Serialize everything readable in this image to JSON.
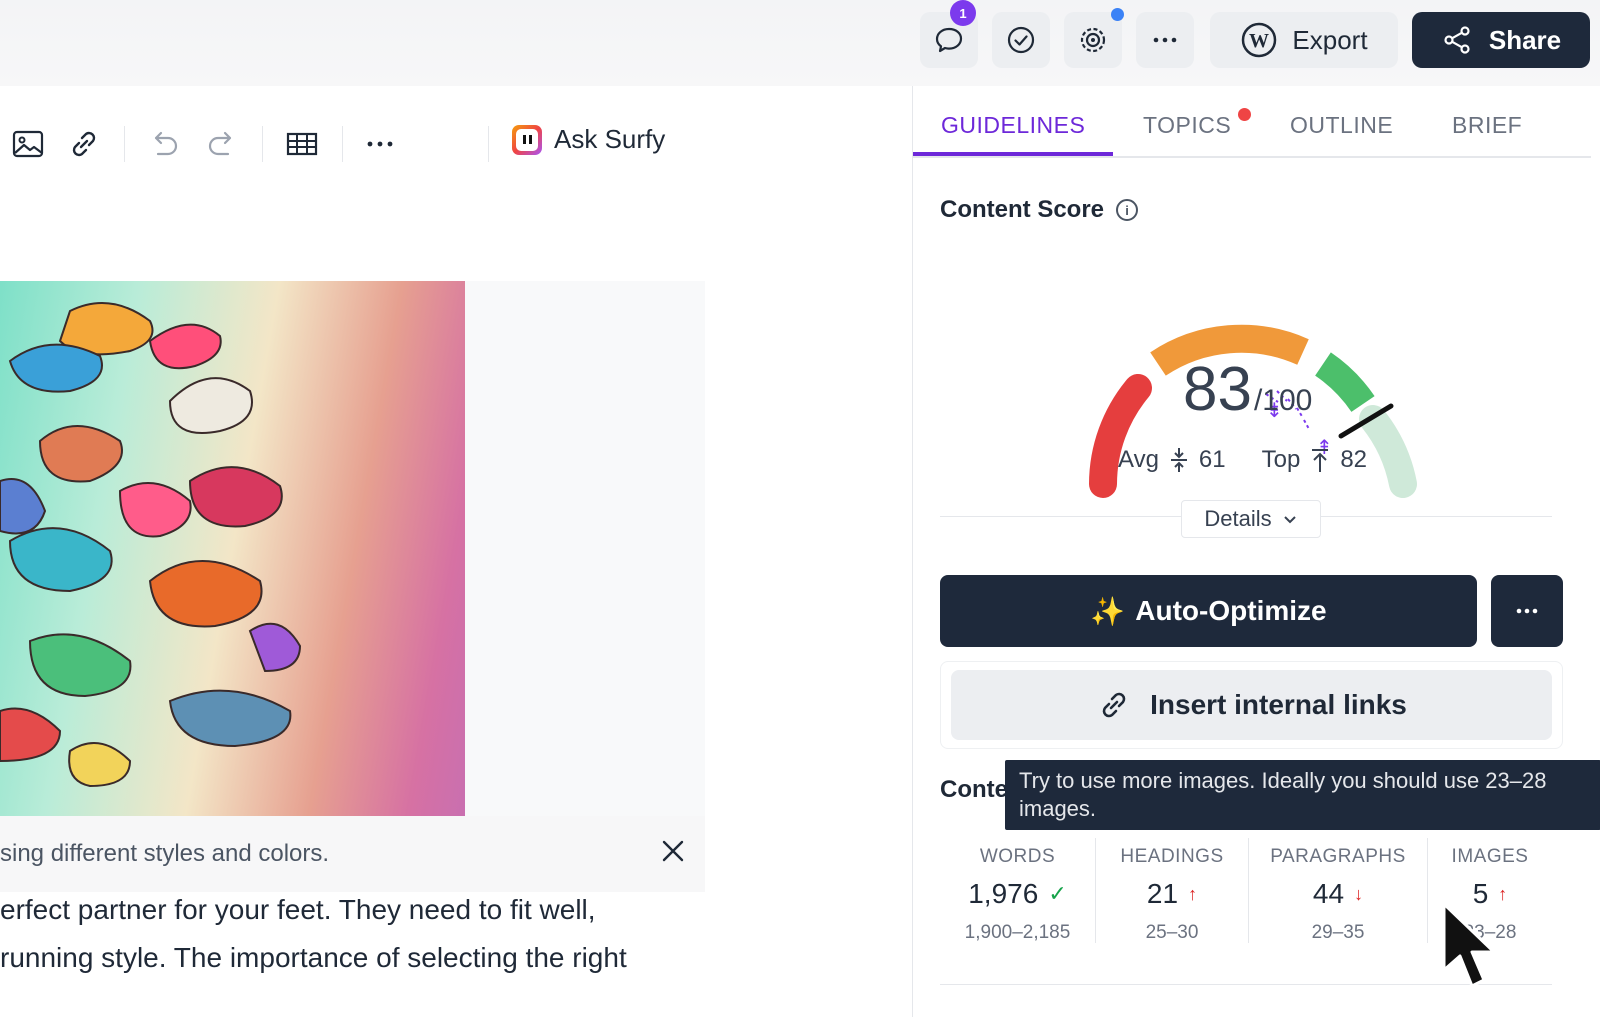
{
  "header": {
    "comments_badge": "1",
    "export_label": "Export",
    "share_label": "Share",
    "icons": [
      "comment-icon",
      "check-circle-icon",
      "settings-icon",
      "more-icon",
      "wordpress-icon",
      "share-icon"
    ]
  },
  "editor": {
    "toolbar": {
      "ask_surfy_label": "Ask Surfy",
      "icons": [
        "image-icon",
        "link-icon",
        "undo-icon",
        "redo-icon",
        "table-icon",
        "more-icon"
      ]
    },
    "caption": "sing different styles and colors.",
    "body_lines": [
      "erfect partner for your feet. They need to fit well,",
      "running style. The importance of selecting the right"
    ]
  },
  "panel": {
    "tabs": [
      {
        "label": "GUIDELINES",
        "active": true
      },
      {
        "label": "TOPICS",
        "has_dot": true
      },
      {
        "label": "OUTLINE"
      },
      {
        "label": "BRIEF"
      }
    ],
    "content_score": {
      "title": "Content Score",
      "score": "83",
      "max": "/100",
      "avg_label": "Avg",
      "avg_value": "61",
      "top_label": "Top",
      "top_value": "82",
      "details_label": "Details"
    },
    "auto_optimize_label": "Auto-Optimize",
    "insert_links_label": "Insert internal links",
    "content_label": "Conte",
    "tooltip": "Try to use more images. Ideally you should use 23–28 images.",
    "metrics": [
      {
        "label": "WORDS",
        "value": "1,976",
        "status": "ok",
        "range": "1,900–2,185"
      },
      {
        "label": "HEADINGS",
        "value": "21",
        "status": "up",
        "range": "25–30"
      },
      {
        "label": "PARAGRAPHS",
        "value": "44",
        "status": "down",
        "range": "29–35"
      },
      {
        "label": "IMAGES",
        "value": "5",
        "status": "up",
        "range": "23–28"
      }
    ]
  },
  "colors": {
    "accent": "#6d28d9",
    "dark": "#1e293b",
    "gauge_red": "#e53e3e",
    "gauge_orange": "#f0993a",
    "gauge_green": "#4cbf6b",
    "gauge_light_green": "#cfe9d9"
  }
}
